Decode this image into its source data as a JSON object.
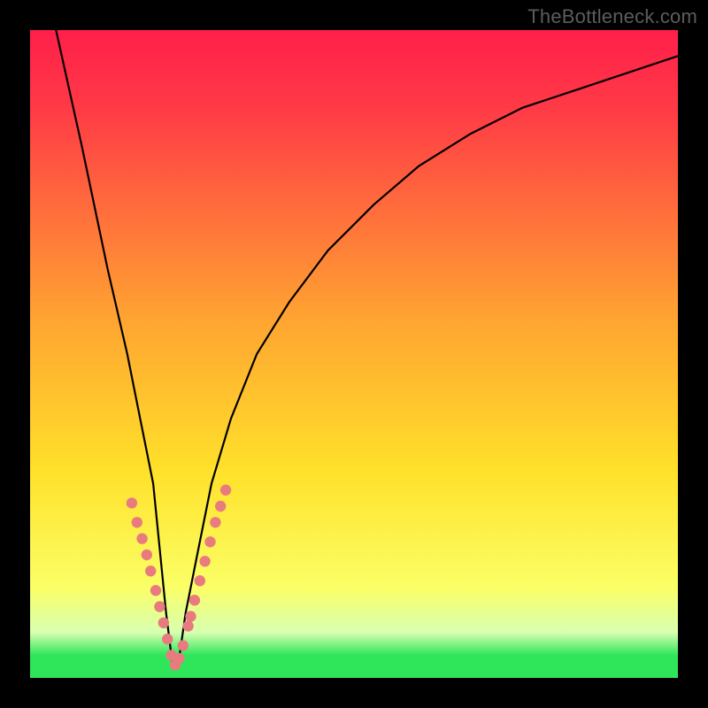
{
  "watermark": "TheBottleneck.com",
  "colors": {
    "top": "#ff1f4a",
    "red": "#ff3a46",
    "orange": "#ffa531",
    "yellow": "#ffe12a",
    "lemon": "#fbff66",
    "pale": "#d8ffb0",
    "green": "#2fe65a",
    "marker": "#e97b7e"
  },
  "chart_data": {
    "type": "line",
    "title": "",
    "xlabel": "",
    "ylabel": "",
    "xlim": [
      0,
      100
    ],
    "ylim": [
      0,
      100
    ],
    "note": "Single V-shaped curve; bottleneck minimum near x≈22. Y read as 100 at top of gradient, 0 at bottom. Values estimated from pixels (no axis ticks visible). Markers are overlaid dots along lower part of curve.",
    "series": [
      {
        "name": "bottleneck-curve",
        "x": [
          4,
          8,
          12,
          15,
          17,
          19,
          20,
          21,
          22,
          23,
          24,
          26,
          28,
          31,
          35,
          40,
          46,
          53,
          60,
          68,
          76,
          85,
          94,
          100
        ],
        "values": [
          100,
          82,
          63,
          50,
          40,
          30,
          20,
          10,
          2,
          3,
          10,
          20,
          30,
          40,
          50,
          58,
          66,
          73,
          79,
          84,
          88,
          91,
          94,
          96
        ]
      }
    ],
    "markers": {
      "name": "highlight-dots",
      "x": [
        15.7,
        16.5,
        17.3,
        18.0,
        18.6,
        19.4,
        20.0,
        20.6,
        21.2,
        21.8,
        22.4,
        23.0,
        23.6,
        24.4,
        24.8,
        25.4,
        26.2,
        27.0,
        27.8,
        28.6,
        29.4,
        30.2
      ],
      "values": [
        27.0,
        24.0,
        21.5,
        19.0,
        16.5,
        13.5,
        11.0,
        8.5,
        6.0,
        3.5,
        2.0,
        3.0,
        5.0,
        8.0,
        9.5,
        12.0,
        15.0,
        18.0,
        21.0,
        24.0,
        26.5,
        29.0
      ],
      "radius_px": 6.2
    }
  }
}
